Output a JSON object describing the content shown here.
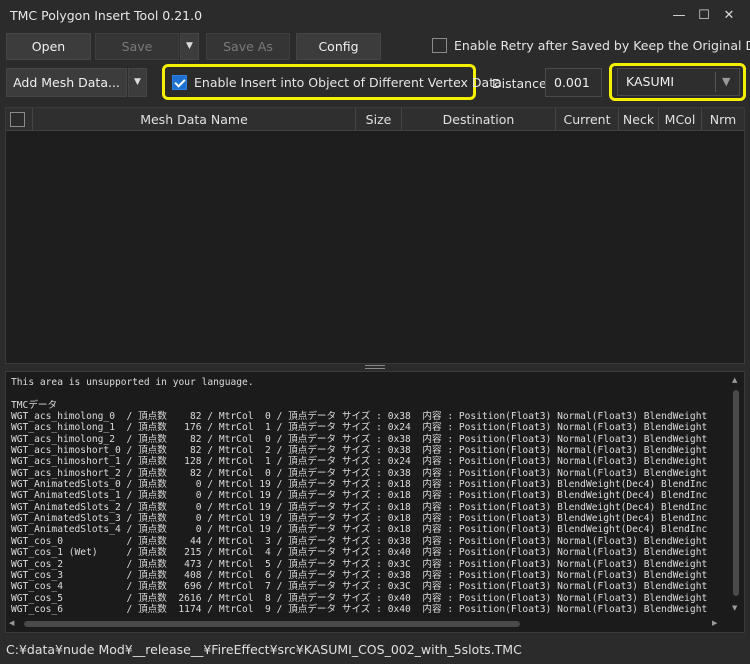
{
  "window": {
    "title": "TMC Polygon Insert Tool 0.21.0"
  },
  "toolbar": {
    "open_label": "Open",
    "save_label": "Save",
    "save_as_label": "Save As",
    "config_label": "Config",
    "enable_retry_label": "Enable Retry after Saved by Keep the Original Data",
    "add_mesh_label": "Add Mesh Data...",
    "enable_insert_label": "Enable Insert into Object of Different Vertex Data",
    "distance_label": "Distance",
    "distance_value": "0.001",
    "character_selected": "KASUMI",
    "highlight_color": "#f5f000",
    "checkbox_color": "#1f6fd1"
  },
  "grid": {
    "columns": [
      "Mesh Data Name",
      "Size",
      "Destination",
      "Current",
      "Neck",
      "MCol",
      "Nrm"
    ]
  },
  "log": {
    "lines": [
      "This area is unsupported in your language.",
      "",
      "TMCデータ",
      "WGT_acs_himolong_0  / 頂点数    82 / MtrCol  0 / 頂点データ サイズ : 0x38  内容 : Position(Float3) Normal(Float3) BlendWeight",
      "WGT_acs_himolong_1  / 頂点数   176 / MtrCol  1 / 頂点データ サイズ : 0x24  内容 : Position(Float3) Normal(Float3) BlendWeight",
      "WGT_acs_himolong_2  / 頂点数    82 / MtrCol  0 / 頂点データ サイズ : 0x38  内容 : Position(Float3) Normal(Float3) BlendWeight",
      "WGT_acs_himoshort_0 / 頂点数    82 / MtrCol  2 / 頂点データ サイズ : 0x38  内容 : Position(Float3) Normal(Float3) BlendWeight",
      "WGT_acs_himoshort_1 / 頂点数   128 / MtrCol  1 / 頂点データ サイズ : 0x24  内容 : Position(Float3) Normal(Float3) BlendWeight",
      "WGT_acs_himoshort_2 / 頂点数    82 / MtrCol  0 / 頂点データ サイズ : 0x38  内容 : Position(Float3) Normal(Float3) BlendWeight",
      "WGT_AnimatedSlots_0 / 頂点数     0 / MtrCol 19 / 頂点データ サイズ : 0x18  内容 : Position(Float3) BlendWeight(Dec4) BlendInc",
      "WGT_AnimatedSlots_1 / 頂点数     0 / MtrCol 19 / 頂点データ サイズ : 0x18  内容 : Position(Float3) BlendWeight(Dec4) BlendInc",
      "WGT_AnimatedSlots_2 / 頂点数     0 / MtrCol 19 / 頂点データ サイズ : 0x18  内容 : Position(Float3) BlendWeight(Dec4) BlendInc",
      "WGT_AnimatedSlots_3 / 頂点数     0 / MtrCol 19 / 頂点データ サイズ : 0x18  内容 : Position(Float3) BlendWeight(Dec4) BlendInc",
      "WGT_AnimatedSlots_4 / 頂点数     0 / MtrCol 19 / 頂点データ サイズ : 0x18  内容 : Position(Float3) BlendWeight(Dec4) BlendInc",
      "WGT_cos_0           / 頂点数    44 / MtrCol  3 / 頂点データ サイズ : 0x38  内容 : Position(Float3) Normal(Float3) BlendWeight",
      "WGT_cos_1 (Wet)     / 頂点数   215 / MtrCol  4 / 頂点データ サイズ : 0x40  内容 : Position(Float3) Normal(Float3) BlendWeight",
      "WGT_cos_2           / 頂点数   473 / MtrCol  5 / 頂点データ サイズ : 0x3C  内容 : Position(Float3) Normal(Float3) BlendWeight",
      "WGT_cos_3           / 頂点数   408 / MtrCol  6 / 頂点データ サイズ : 0x38  内容 : Position(Float3) Normal(Float3) BlendWeight",
      "WGT_cos_4           / 頂点数   696 / MtrCol  7 / 頂点データ サイズ : 0x3C  内容 : Position(Float3) Normal(Float3) BlendWeight",
      "WGT_cos_5           / 頂点数  2616 / MtrCol  8 / 頂点データ サイズ : 0x40  内容 : Position(Float3) Normal(Float3) BlendWeight",
      "WGT_cos_6           / 頂点数  1174 / MtrCol  9 / 頂点データ サイズ : 0x40  内容 : Position(Float3) Normal(Float3) BlendWeight"
    ]
  },
  "status": {
    "path": "C:¥data¥nude Mod¥__release__¥FireEffect¥src¥KASUMI_COS_002_with_5slots.TMC"
  }
}
